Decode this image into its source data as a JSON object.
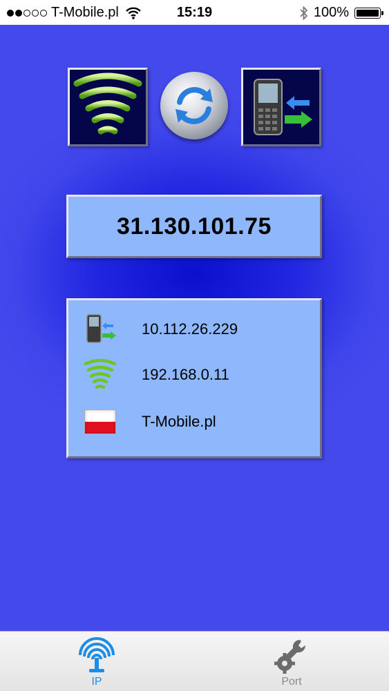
{
  "status_bar": {
    "carrier": "T-Mobile.pl",
    "time": "15:19",
    "battery": "100%",
    "signal_dots_filled": 2,
    "signal_dots_total": 5,
    "battery_level": 1.0
  },
  "main": {
    "buttons": {
      "wifi": "wifi-signal-icon",
      "refresh": "refresh-icon",
      "mobile": "mobile-phone-transfer-icon"
    },
    "public_ip": "31.130.101.75",
    "info": {
      "mobile_ip": "10.112.26.229",
      "wifi_ip": "192.168.0.11",
      "carrier": "T-Mobile.pl",
      "carrier_flag": "poland-flag-icon"
    }
  },
  "tabs": [
    {
      "label": "IP",
      "icon": "antenna-icon",
      "active": true
    },
    {
      "label": "Port",
      "icon": "wrench-gear-icon",
      "active": false
    }
  ],
  "colors": {
    "background_blue": "#4348ea",
    "tile_light": "#8fb7fb",
    "tile_dark": "#05064a",
    "tab_active": "#1a8de8",
    "tab_inactive": "#8a8a8a",
    "wifi_green": "#7ed321"
  }
}
